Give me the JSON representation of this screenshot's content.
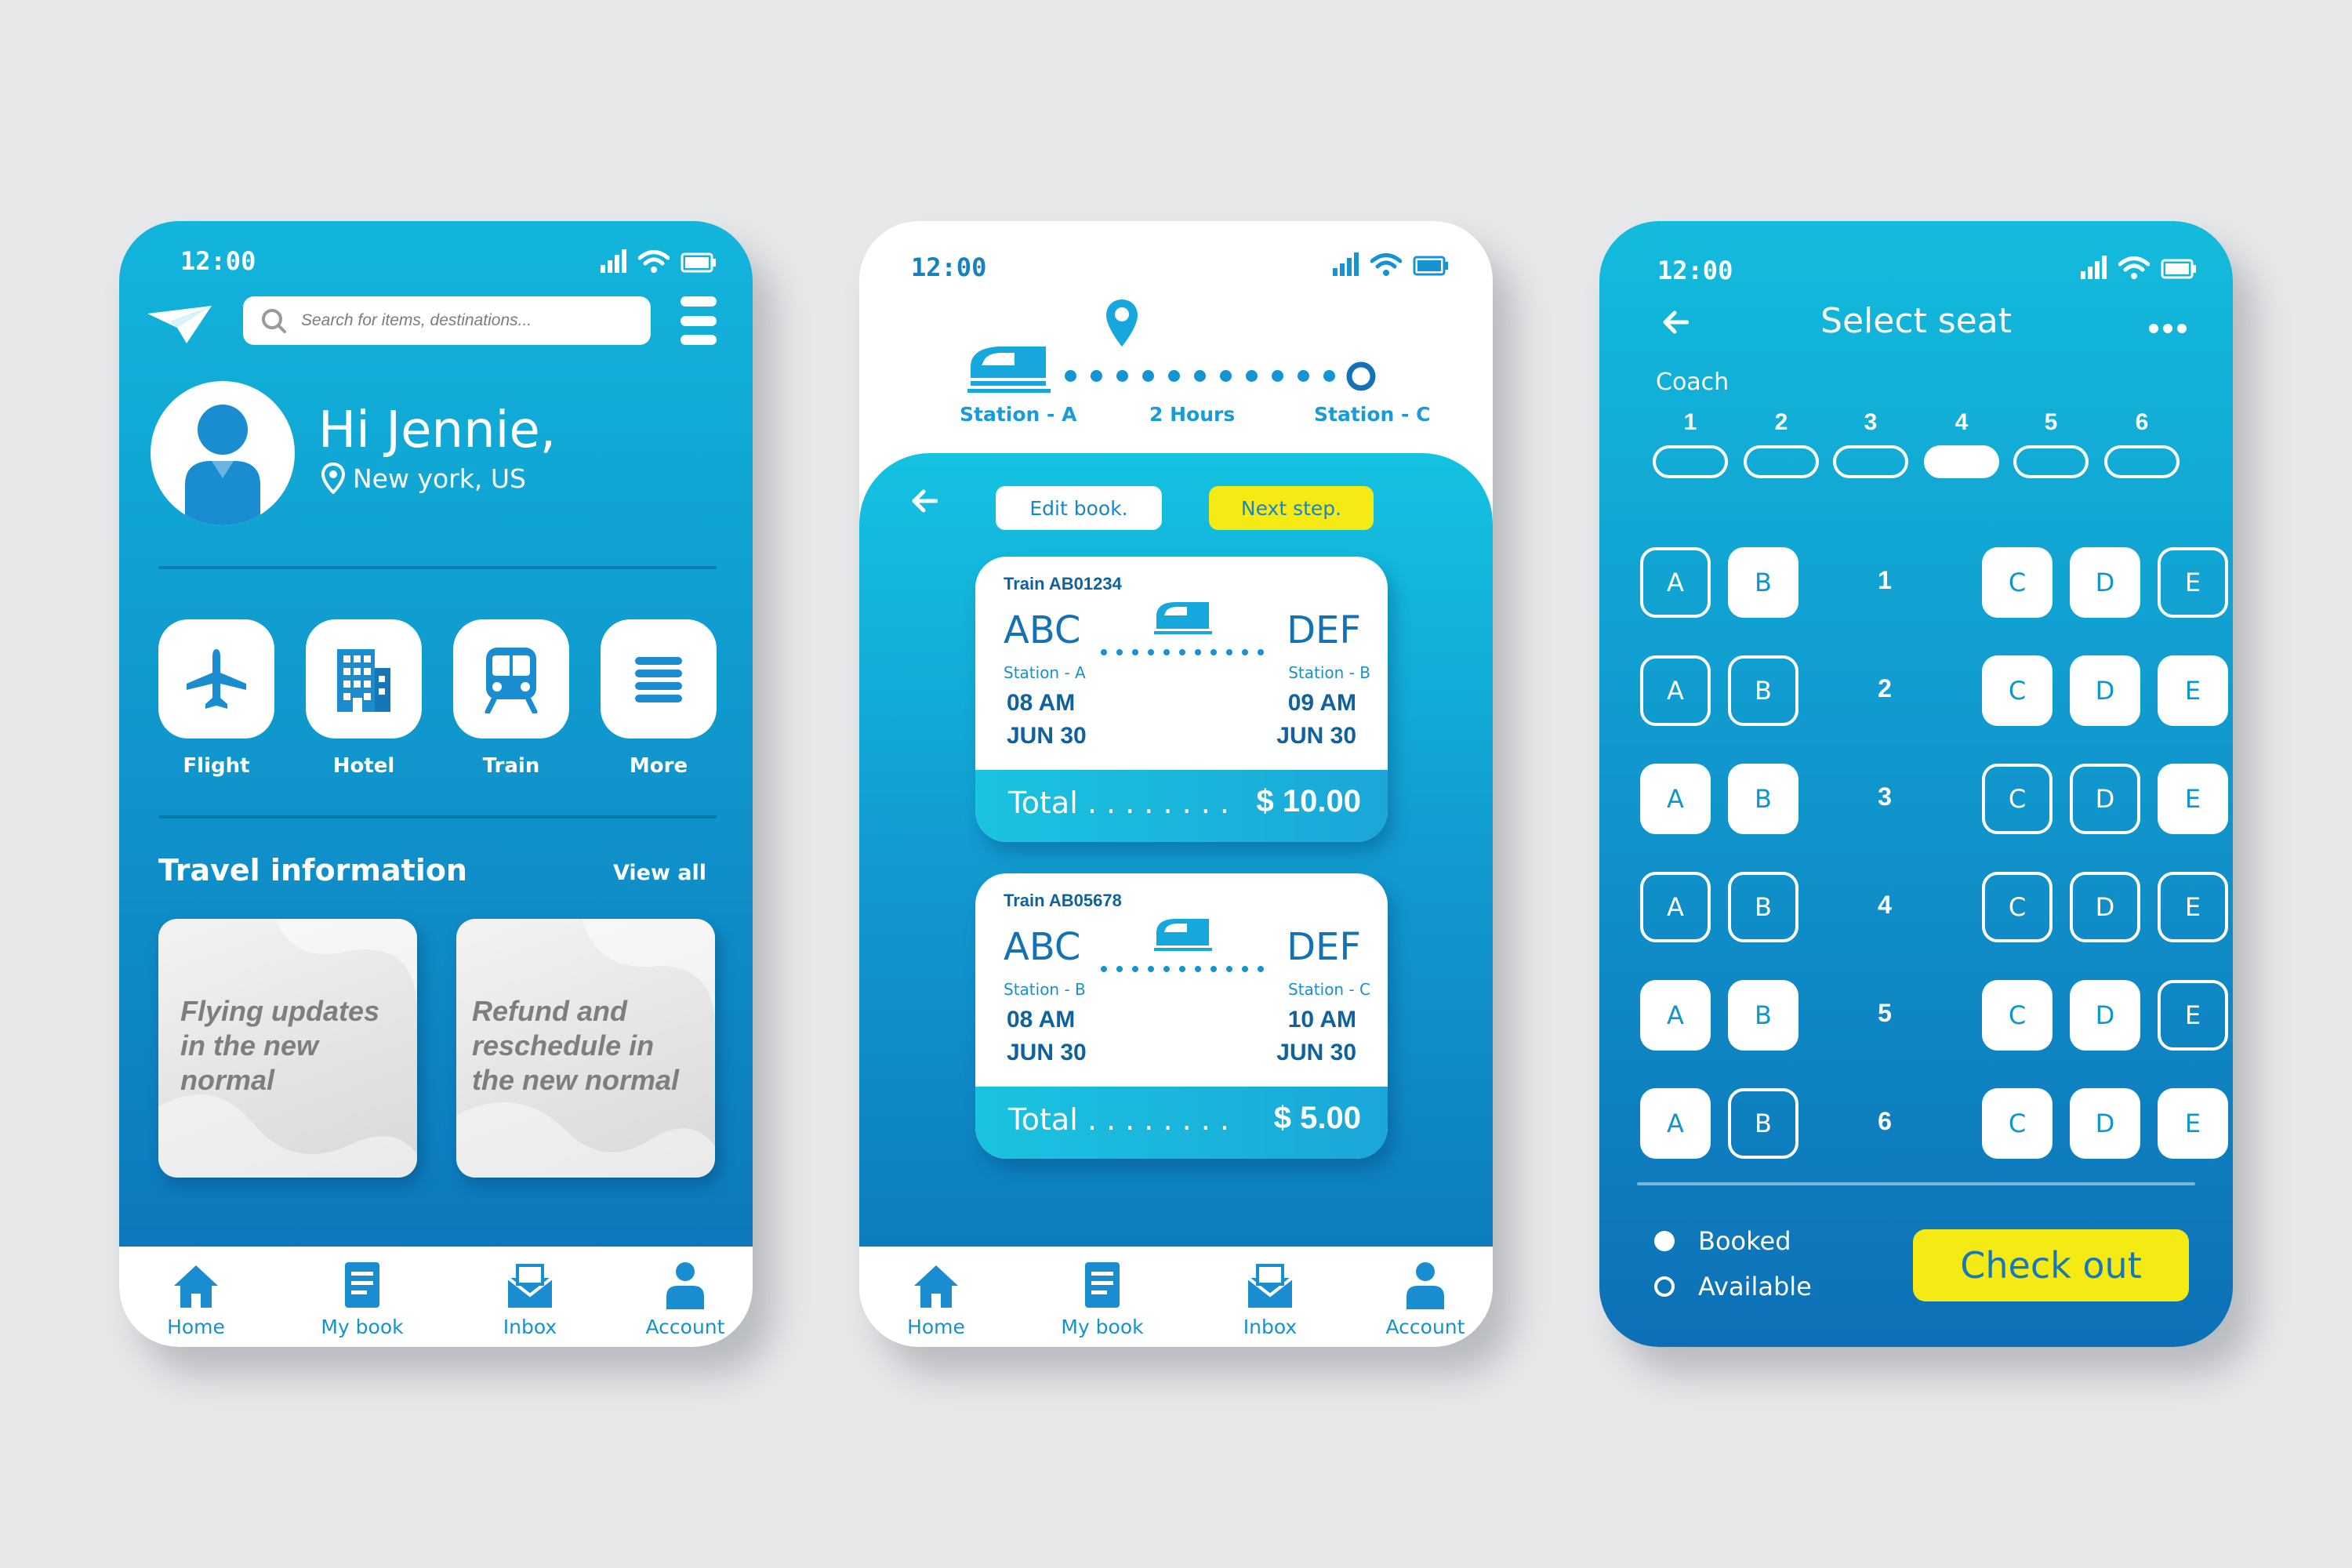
{
  "colors": {
    "primary_blue": "#1096cd",
    "light_blue": "#14c2e1",
    "dark_blue": "#0c72b8",
    "accent_yellow": "#f5ea14",
    "background": "#e7e8ea",
    "card_gray": "#e0e0e0"
  },
  "phone1": {
    "status": {
      "time": "12:00",
      "icons": [
        "signal-icon",
        "wifi-icon",
        "battery-icon"
      ]
    },
    "logo_icon": "paper-plane-icon",
    "search": {
      "placeholder": "Search for items, destinations...",
      "icon": "search-icon"
    },
    "menu_icon": "menu-icon",
    "greeting": "Hi Jennie,",
    "location": "New york, US",
    "categories": [
      {
        "label": "Flight",
        "icon": "airplane-icon"
      },
      {
        "label": "Hotel",
        "icon": "hotel-icon"
      },
      {
        "label": "Train",
        "icon": "train-icon"
      },
      {
        "label": "More",
        "icon": "more-icon"
      }
    ],
    "travel_info": {
      "title": "Travel information",
      "view_all": "View all",
      "cards": [
        {
          "text": "Flying updates in the new normal"
        },
        {
          "text": "Refund and reschedule in the new normal"
        }
      ]
    },
    "nav": [
      {
        "label": "Home",
        "icon": "home-icon"
      },
      {
        "label": "My book",
        "icon": "book-icon"
      },
      {
        "label": "Inbox",
        "icon": "inbox-icon"
      },
      {
        "label": "Account",
        "icon": "account-icon"
      }
    ]
  },
  "phone2": {
    "status": {
      "time": "12:00",
      "icons": [
        "signal-icon",
        "wifi-icon",
        "battery-icon"
      ]
    },
    "route": {
      "from": "Station - A",
      "duration": "2 Hours",
      "to": "Station - C"
    },
    "edit_button": "Edit book.",
    "next_button": "Next step.",
    "tickets": [
      {
        "train": "Train AB01234",
        "from_code": "ABC",
        "from_station": "Station - A",
        "to_code": "DEF",
        "to_station": "Station - B",
        "dep_time": "08 AM",
        "dep_date": "JUN 30",
        "arr_time": "09 AM",
        "arr_date": "JUN 30",
        "total_label": "Total . . . . . . . .",
        "total": "$ 10.00"
      },
      {
        "train": "Train AB05678",
        "from_code": "ABC",
        "from_station": "Station - B",
        "to_code": "DEF",
        "to_station": "Station - C",
        "dep_time": "08 AM",
        "dep_date": "JUN 30",
        "arr_time": "10 AM",
        "arr_date": "JUN 30",
        "total_label": "Total . . . . . . . .",
        "total": "$ 5.00"
      }
    ],
    "nav": [
      {
        "label": "Home",
        "icon": "home-icon"
      },
      {
        "label": "My book",
        "icon": "book-icon"
      },
      {
        "label": "Inbox",
        "icon": "inbox-icon"
      },
      {
        "label": "Account",
        "icon": "account-icon"
      }
    ]
  },
  "phone3": {
    "status": {
      "time": "12:00",
      "icons": [
        "signal-icon",
        "wifi-icon",
        "battery-icon"
      ]
    },
    "title": "Select seat",
    "coach_label": "Coach",
    "coaches": [
      "1",
      "2",
      "3",
      "4",
      "5",
      "6"
    ],
    "selected_coach": "4",
    "seat_rows": [
      {
        "row": "1",
        "A": "available",
        "B": "booked",
        "C": "booked",
        "D": "booked",
        "E": "available"
      },
      {
        "row": "2",
        "A": "available",
        "B": "available",
        "C": "booked",
        "D": "booked",
        "E": "booked"
      },
      {
        "row": "3",
        "A": "booked",
        "B": "booked",
        "C": "available",
        "D": "available",
        "E": "booked"
      },
      {
        "row": "4",
        "A": "available",
        "B": "available",
        "C": "available",
        "D": "available",
        "E": "available"
      },
      {
        "row": "5",
        "A": "booked",
        "B": "booked",
        "C": "booked",
        "D": "booked",
        "E": "available"
      },
      {
        "row": "6",
        "A": "booked",
        "B": "available",
        "C": "booked",
        "D": "booked",
        "E": "booked"
      }
    ],
    "seat_letters": [
      "A",
      "B",
      "C",
      "D",
      "E"
    ],
    "legend": {
      "booked": "Booked",
      "available": "Available"
    },
    "checkout": "Check out"
  }
}
